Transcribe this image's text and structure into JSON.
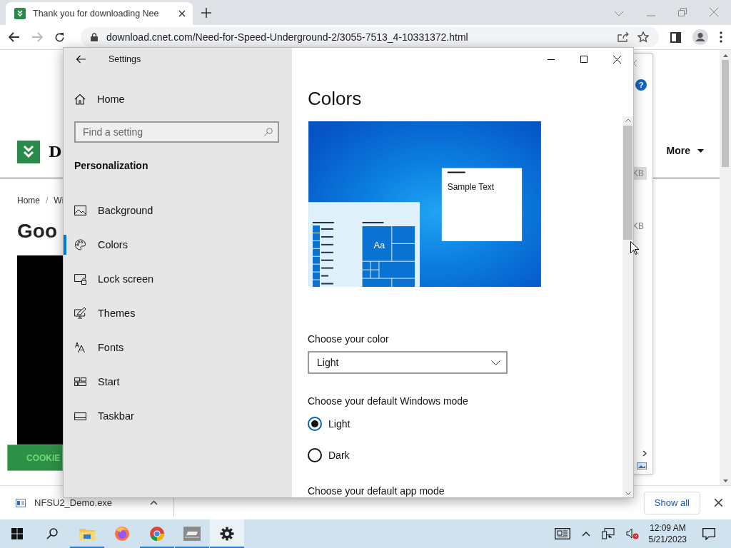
{
  "browser": {
    "tab": {
      "title": "Thank you for downloading Nee"
    },
    "url": "download.cnet.com/Need-for-Speed-Underground-2/3055-7513_4-10331372.html"
  },
  "page": {
    "logo_text": "D",
    "help_label": "?",
    "nav_more": "More",
    "breadcrumb": {
      "items": [
        "Home",
        "Wi"
      ],
      "separator": "/"
    },
    "heading": "Goo",
    "cookie_button": "COOKIE",
    "dialog_sizes": [
      "KB",
      "KB"
    ]
  },
  "settings": {
    "title": "Settings",
    "home": "Home",
    "search": {
      "placeholder": "Find a setting"
    },
    "section": "Personalization",
    "nav": [
      {
        "label": "Background",
        "kind": "background",
        "selected": false
      },
      {
        "label": "Colors",
        "kind": "colors",
        "selected": true
      },
      {
        "label": "Lock screen",
        "kind": "lock",
        "selected": false
      },
      {
        "label": "Themes",
        "kind": "themes",
        "selected": false
      },
      {
        "label": "Fonts",
        "kind": "fonts",
        "selected": false
      },
      {
        "label": "Start",
        "kind": "start",
        "selected": false
      },
      {
        "label": "Taskbar",
        "kind": "taskbar",
        "selected": false
      }
    ],
    "page_title": "Colors",
    "preview": {
      "sample_text": "Sample Text",
      "tile_text": "Aa"
    },
    "color_label": "Choose your color",
    "color_value": "Light",
    "mode_label": "Choose your default Windows mode",
    "modes": [
      {
        "label": "Light",
        "selected": true
      },
      {
        "label": "Dark",
        "selected": false
      }
    ],
    "app_mode_label": "Choose your default app mode"
  },
  "downloads": {
    "file": "NFSU2_Demo.exe",
    "show_all": "Show all"
  },
  "taskbar": {
    "apps": [
      {
        "kind": "explorer",
        "running": true,
        "selected": false
      },
      {
        "kind": "firefox",
        "running": false,
        "selected": false
      },
      {
        "kind": "chrome",
        "running": true,
        "selected": false
      },
      {
        "kind": "nfs",
        "running": true,
        "selected": false
      },
      {
        "kind": "settings",
        "running": true,
        "selected": true
      }
    ],
    "time": "12:09 AM",
    "date": "5/21/2023"
  }
}
